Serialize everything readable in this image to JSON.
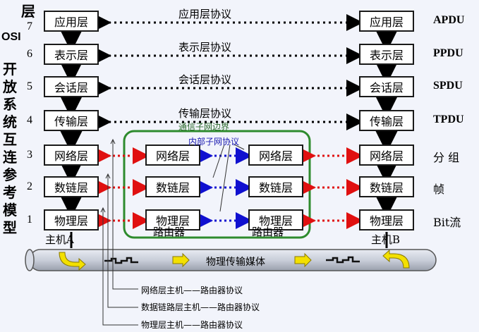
{
  "left_title": {
    "top": "层",
    "osi": "OSI",
    "chars": [
      "开",
      "放",
      "系",
      "统",
      "互",
      "连",
      "参",
      "考",
      "模",
      "型"
    ]
  },
  "layer_numbers": [
    "7",
    "6",
    "5",
    "4",
    "3",
    "2",
    "1"
  ],
  "host_layers": [
    "应用层",
    "表示层",
    "会话层",
    "传输层",
    "网络层",
    "数链层",
    "物理层"
  ],
  "router_layers": [
    "网络层",
    "数链层",
    "物理层"
  ],
  "protocols": [
    "应用层协议",
    "表示层协议",
    "会话层协议",
    "传输层协议"
  ],
  "pdus": [
    "APDU",
    "PPDU",
    "SPDU",
    "TPDU",
    "分 组",
    "帧",
    "Bit流"
  ],
  "subnet": {
    "boundary": "通信子网边界",
    "internal": "内部子网协议"
  },
  "routers": [
    "路由器",
    "路由器"
  ],
  "hosts": {
    "a": "主机A",
    "b": "主机B"
  },
  "medium": "物理传输媒体",
  "footnotes": [
    "网络层主机——路由器协议",
    "数据链路层主机——路由器协议",
    "物理层主机——路由器协议"
  ],
  "colors": {
    "green_frame": "#2e8b2e",
    "red_arrow": "#e01010",
    "blue_arrow": "#1010d0",
    "medium_tube": "#cfd3dc",
    "yellow_arrow": "#f3e000"
  }
}
